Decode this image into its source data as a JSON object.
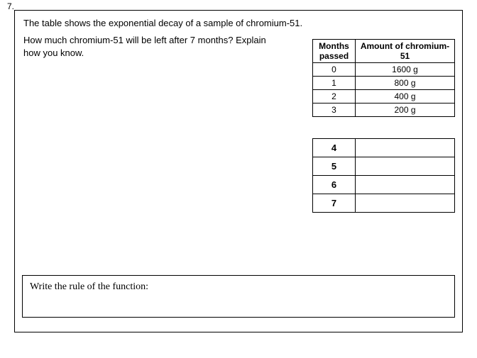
{
  "question_number": "7.",
  "intro": "The table shows the exponential decay of a sample of chromium-51.",
  "question": "How much chromium-51 will be left after 7 months? Explain how you know.",
  "table1": {
    "header_col1_line1": "Months",
    "header_col1_line2": "passed",
    "header_col2_line1": "Amount of chromium-",
    "header_col2_line2": "51",
    "rows": [
      {
        "months": "0",
        "amount": "1600 g"
      },
      {
        "months": "1",
        "amount": "800 g"
      },
      {
        "months": "2",
        "amount": "400 g"
      },
      {
        "months": "3",
        "amount": "200 g"
      }
    ]
  },
  "table2": {
    "rows": [
      {
        "months": "4",
        "amount": ""
      },
      {
        "months": "5",
        "amount": ""
      },
      {
        "months": "6",
        "amount": ""
      },
      {
        "months": "7",
        "amount": ""
      }
    ]
  },
  "rule_prompt": "Write the rule of the function:"
}
